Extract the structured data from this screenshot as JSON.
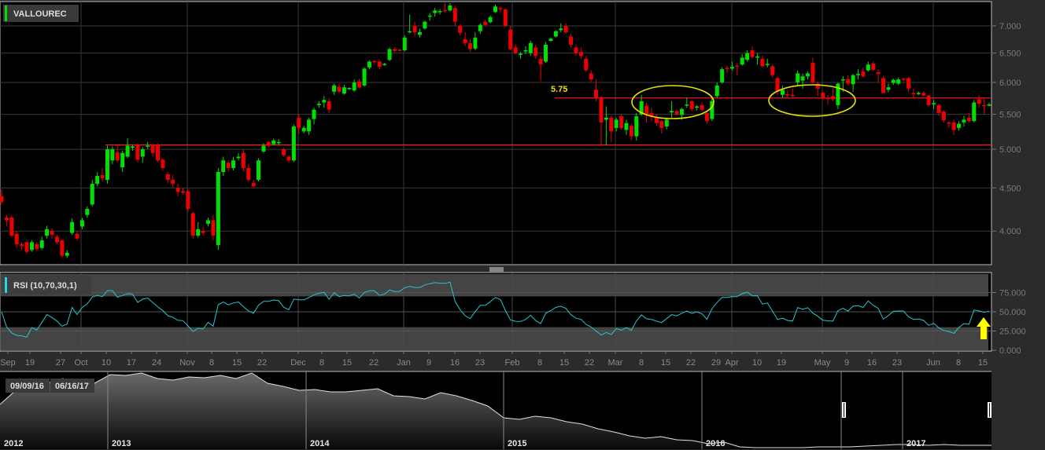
{
  "colors": {
    "background": "#2b2b2b",
    "panel": "#000000",
    "grid": "#3a3a3a",
    "up": "#00e000",
    "down": "#ee0000",
    "hline": "#ff1a1a",
    "annotation": "#e8e000",
    "rsi_line": "#22c8d0",
    "rsi_band": "#444444",
    "navigator_line": "#e0e0e0"
  },
  "chart_data": [
    {
      "type": "candlestick",
      "title": "VALLOUREC",
      "scale": "log",
      "ylim": [
        3.65,
        7.48
      ],
      "grid": true,
      "yticks": [
        {
          "value": 7.0,
          "label": "7.000"
        },
        {
          "value": 6.5,
          "label": "6.500"
        },
        {
          "value": 6.0,
          "label": "6.000"
        },
        {
          "value": 5.5,
          "label": "5.500"
        },
        {
          "value": 5.0,
          "label": "5.000"
        },
        {
          "value": 4.5,
          "label": "4.500"
        },
        {
          "value": 4.0,
          "label": "4.000"
        }
      ],
      "xticks": [
        "Sep",
        "19",
        "27",
        "Oct",
        "10",
        "17",
        "24",
        "Nov",
        "8",
        "15",
        "22",
        "Dec",
        "8",
        "15",
        "22",
        "Jan",
        "9",
        "16",
        "23",
        "Feb",
        "8",
        "15",
        "22",
        "Mar",
        "8",
        "15",
        "22",
        "29",
        "Apr",
        "10",
        "19",
        "May",
        "9",
        "16",
        "23",
        "Jun",
        "8",
        "15"
      ],
      "annotations": {
        "hlines": [
          {
            "value": 5.75,
            "label": "5.75"
          },
          {
            "value": 5.06,
            "label": ""
          }
        ],
        "highlights": [
          "ellipse",
          "ellipse"
        ],
        "arrow": "up"
      },
      "ohlc": [
        [
          4.4,
          4.48,
          4.3,
          4.33
        ],
        [
          4.15,
          4.18,
          4.05,
          4.12
        ],
        [
          4.15,
          4.17,
          3.93,
          3.95
        ],
        [
          3.97,
          4.0,
          3.82,
          3.86
        ],
        [
          3.86,
          3.88,
          3.8,
          3.84
        ],
        [
          3.88,
          3.9,
          3.76,
          3.78
        ],
        [
          3.8,
          3.9,
          3.78,
          3.88
        ],
        [
          3.86,
          3.88,
          3.79,
          3.81
        ],
        [
          3.82,
          3.94,
          3.8,
          3.9
        ],
        [
          3.95,
          4.06,
          3.92,
          4.02
        ],
        [
          4.0,
          4.03,
          3.92,
          3.96
        ],
        [
          3.94,
          3.96,
          3.86,
          3.88
        ],
        [
          3.9,
          3.91,
          3.72,
          3.74
        ],
        [
          3.74,
          3.8,
          3.72,
          3.77
        ],
        [
          3.98,
          4.14,
          3.96,
          4.1
        ],
        [
          3.97,
          4.0,
          3.9,
          3.92
        ],
        [
          4.05,
          4.15,
          4.02,
          4.12
        ],
        [
          4.18,
          4.28,
          4.15,
          4.25
        ],
        [
          4.3,
          4.6,
          4.28,
          4.55
        ],
        [
          4.55,
          4.7,
          4.52,
          4.65
        ],
        [
          4.66,
          4.75,
          4.58,
          4.62
        ],
        [
          4.6,
          5.05,
          4.55,
          5.0
        ],
        [
          4.85,
          5.04,
          4.8,
          5.0
        ],
        [
          4.96,
          5.05,
          4.82,
          4.85
        ],
        [
          4.76,
          4.98,
          4.7,
          4.95
        ],
        [
          4.9,
          5.15,
          4.88,
          5.05
        ],
        [
          5.02,
          5.06,
          4.98,
          5.04
        ],
        [
          5.06,
          5.08,
          4.82,
          4.86
        ],
        [
          4.9,
          5.03,
          4.82,
          5.0
        ],
        [
          5.04,
          5.1,
          5.0,
          5.05
        ],
        [
          5.06,
          5.08,
          4.9,
          4.95
        ],
        [
          5.06,
          5.08,
          4.83,
          4.85
        ],
        [
          4.86,
          4.88,
          4.72,
          4.75
        ],
        [
          4.67,
          4.7,
          4.56,
          4.6
        ],
        [
          4.6,
          4.66,
          4.5,
          4.55
        ],
        [
          4.5,
          4.55,
          4.4,
          4.45
        ],
        [
          4.46,
          4.5,
          4.42,
          4.44
        ],
        [
          4.46,
          4.48,
          4.22,
          4.25
        ],
        [
          4.2,
          4.22,
          3.92,
          3.95
        ],
        [
          3.95,
          4.1,
          3.93,
          4.02
        ],
        [
          4.0,
          4.05,
          3.95,
          3.98
        ],
        [
          4.08,
          4.15,
          4.05,
          4.12
        ],
        [
          4.12,
          4.18,
          3.9,
          3.95
        ],
        [
          3.85,
          4.75,
          3.8,
          4.7
        ],
        [
          4.7,
          4.9,
          4.65,
          4.85
        ],
        [
          4.82,
          4.85,
          4.7,
          4.75
        ],
        [
          4.75,
          4.9,
          4.72,
          4.85
        ],
        [
          4.88,
          4.95,
          4.85,
          4.9
        ],
        [
          4.95,
          5.0,
          4.7,
          4.75
        ],
        [
          4.75,
          4.8,
          4.58,
          4.6
        ],
        [
          4.56,
          4.6,
          4.5,
          4.52
        ],
        [
          4.6,
          4.88,
          4.58,
          4.85
        ],
        [
          4.97,
          5.08,
          4.95,
          5.05
        ],
        [
          5.1,
          5.12,
          5.02,
          5.05
        ],
        [
          5.07,
          5.15,
          5.05,
          5.12
        ],
        [
          5.1,
          5.14,
          5.06,
          5.1
        ],
        [
          5.0,
          5.02,
          4.9,
          4.92
        ],
        [
          4.9,
          4.92,
          4.82,
          4.85
        ],
        [
          4.85,
          5.35,
          4.83,
          5.32
        ],
        [
          5.45,
          5.5,
          5.22,
          5.3
        ],
        [
          5.25,
          5.33,
          5.22,
          5.3
        ],
        [
          5.25,
          5.45,
          5.2,
          5.42
        ],
        [
          5.43,
          5.6,
          5.35,
          5.57
        ],
        [
          5.64,
          5.7,
          5.6,
          5.66
        ],
        [
          5.68,
          5.78,
          5.6,
          5.72
        ],
        [
          5.7,
          5.75,
          5.52,
          5.57
        ],
        [
          5.85,
          5.98,
          5.8,
          5.95
        ],
        [
          5.93,
          5.97,
          5.83,
          5.85
        ],
        [
          5.82,
          5.96,
          5.8,
          5.92
        ],
        [
          5.9,
          5.92,
          5.88,
          5.91
        ],
        [
          5.87,
          6.05,
          5.85,
          6.0
        ],
        [
          6.02,
          6.06,
          5.9,
          5.92
        ],
        [
          5.95,
          6.25,
          5.93,
          6.23
        ],
        [
          6.25,
          6.37,
          6.22,
          6.35
        ],
        [
          6.36,
          6.38,
          6.3,
          6.35
        ],
        [
          6.35,
          6.38,
          6.22,
          6.26
        ],
        [
          6.3,
          6.33,
          6.28,
          6.31
        ],
        [
          6.38,
          6.6,
          6.36,
          6.57
        ],
        [
          6.57,
          6.6,
          6.52,
          6.54
        ],
        [
          6.56,
          6.58,
          6.53,
          6.55
        ],
        [
          6.55,
          6.82,
          6.53,
          6.78
        ],
        [
          6.88,
          7.22,
          6.86,
          6.9
        ],
        [
          7.0,
          7.08,
          6.8,
          6.88
        ],
        [
          6.83,
          6.95,
          6.78,
          6.88
        ],
        [
          6.95,
          7.1,
          6.93,
          7.08
        ],
        [
          7.18,
          7.25,
          7.1,
          7.2
        ],
        [
          7.25,
          7.35,
          7.18,
          7.3
        ],
        [
          7.28,
          7.33,
          7.22,
          7.29
        ],
        [
          7.31,
          7.45,
          7.25,
          7.3
        ],
        [
          7.3,
          7.45,
          7.28,
          7.4
        ],
        [
          7.35,
          7.4,
          7.0,
          7.08
        ],
        [
          7.0,
          7.03,
          6.82,
          6.87
        ],
        [
          6.75,
          6.88,
          6.62,
          6.68
        ],
        [
          6.68,
          6.75,
          6.52,
          6.57
        ],
        [
          6.58,
          6.88,
          6.55,
          6.78
        ],
        [
          6.9,
          7.05,
          6.85,
          7.02
        ],
        [
          7.08,
          7.12,
          7.0,
          7.02
        ],
        [
          7.07,
          7.2,
          7.05,
          7.17
        ],
        [
          7.27,
          7.42,
          7.25,
          7.38
        ],
        [
          7.35,
          7.38,
          7.25,
          7.33
        ],
        [
          7.32,
          7.35,
          6.98,
          7.0
        ],
        [
          6.93,
          7.0,
          6.55,
          6.57
        ],
        [
          6.6,
          6.65,
          6.48,
          6.5
        ],
        [
          6.47,
          6.52,
          6.4,
          6.49
        ],
        [
          6.53,
          6.62,
          6.48,
          6.55
        ],
        [
          6.5,
          6.72,
          6.45,
          6.68
        ],
        [
          6.6,
          6.65,
          6.4,
          6.45
        ],
        [
          6.4,
          6.45,
          6.02,
          6.3
        ],
        [
          6.35,
          6.7,
          6.33,
          6.65
        ],
        [
          6.72,
          6.78,
          6.7,
          6.76
        ],
        [
          6.8,
          6.92,
          6.78,
          6.9
        ],
        [
          6.92,
          7.05,
          6.88,
          6.95
        ],
        [
          7.0,
          7.05,
          6.85,
          6.88
        ],
        [
          6.8,
          6.85,
          6.6,
          6.65
        ],
        [
          6.6,
          6.65,
          6.45,
          6.5
        ],
        [
          6.52,
          6.6,
          6.4,
          6.45
        ],
        [
          6.4,
          6.45,
          6.18,
          6.2
        ],
        [
          6.15,
          6.2,
          6.0,
          6.05
        ],
        [
          5.88,
          6.05,
          5.7,
          5.76
        ],
        [
          5.76,
          5.78,
          5.05,
          5.38
        ],
        [
          5.42,
          5.62,
          5.05,
          5.45
        ],
        [
          5.45,
          5.48,
          5.1,
          5.25
        ],
        [
          5.3,
          5.45,
          5.25,
          5.42
        ],
        [
          5.47,
          5.5,
          5.28,
          5.3
        ],
        [
          5.27,
          5.42,
          5.2,
          5.37
        ],
        [
          5.33,
          5.36,
          5.12,
          5.18
        ],
        [
          5.18,
          5.52,
          5.12,
          5.47
        ],
        [
          5.5,
          5.8,
          5.48,
          5.7
        ],
        [
          5.63,
          5.68,
          5.38,
          5.5
        ],
        [
          5.52,
          5.6,
          5.4,
          5.46
        ],
        [
          5.46,
          5.5,
          5.33,
          5.37
        ],
        [
          5.4,
          5.42,
          5.22,
          5.3
        ],
        [
          5.32,
          5.45,
          5.28,
          5.42
        ],
        [
          5.53,
          5.7,
          5.45,
          5.55
        ],
        [
          5.55,
          5.58,
          5.48,
          5.5
        ],
        [
          5.49,
          5.6,
          5.42,
          5.58
        ],
        [
          5.64,
          5.76,
          5.6,
          5.65
        ],
        [
          5.7,
          5.72,
          5.55,
          5.58
        ],
        [
          5.6,
          5.64,
          5.56,
          5.62
        ],
        [
          5.64,
          5.68,
          5.55,
          5.57
        ],
        [
          5.52,
          5.55,
          5.36,
          5.4
        ],
        [
          5.43,
          5.75,
          5.4,
          5.7
        ],
        [
          5.78,
          6.0,
          5.75,
          5.95
        ],
        [
          6.0,
          6.25,
          5.98,
          6.22
        ],
        [
          6.24,
          6.28,
          6.15,
          6.22
        ],
        [
          6.23,
          6.35,
          6.2,
          6.26
        ],
        [
          6.28,
          6.32,
          6.12,
          6.27
        ],
        [
          6.3,
          6.48,
          6.28,
          6.42
        ],
        [
          6.38,
          6.55,
          6.35,
          6.5
        ],
        [
          6.55,
          6.62,
          6.4,
          6.43
        ],
        [
          6.43,
          6.5,
          6.3,
          6.44
        ],
        [
          6.4,
          6.45,
          6.25,
          6.27
        ],
        [
          6.29,
          6.4,
          6.25,
          6.31
        ],
        [
          6.27,
          6.3,
          6.08,
          6.12
        ],
        [
          6.07,
          6.1,
          5.8,
          5.85
        ],
        [
          5.8,
          5.95,
          5.75,
          5.88
        ],
        [
          5.81,
          5.88,
          5.75,
          5.8
        ],
        [
          5.8,
          5.9,
          5.75,
          5.78
        ],
        [
          6.0,
          6.2,
          5.95,
          6.15
        ],
        [
          6.03,
          6.15,
          5.9,
          6.1
        ],
        [
          6.1,
          6.18,
          6.05,
          6.15
        ],
        [
          6.33,
          6.42,
          5.98,
          6.0
        ],
        [
          5.98,
          6.02,
          5.78,
          5.9
        ],
        [
          5.83,
          5.85,
          5.72,
          5.76
        ],
        [
          5.75,
          5.8,
          5.65,
          5.74
        ],
        [
          5.78,
          5.9,
          5.7,
          5.73
        ],
        [
          5.64,
          6.0,
          5.58,
          5.98
        ],
        [
          6.05,
          6.1,
          5.85,
          6.05
        ],
        [
          6.05,
          6.12,
          5.95,
          5.98
        ],
        [
          5.97,
          6.14,
          5.85,
          6.12
        ],
        [
          6.12,
          6.22,
          6.05,
          6.14
        ],
        [
          6.18,
          6.25,
          6.08,
          6.1
        ],
        [
          6.2,
          6.35,
          6.18,
          6.3
        ],
        [
          6.32,
          6.35,
          6.18,
          6.21
        ],
        [
          6.17,
          6.22,
          6.0,
          6.14
        ],
        [
          6.07,
          6.1,
          5.82,
          5.83
        ],
        [
          5.88,
          5.98,
          5.84,
          5.92
        ],
        [
          5.99,
          6.06,
          5.96,
          6.04
        ],
        [
          5.98,
          6.08,
          5.96,
          6.05
        ],
        [
          6.06,
          6.08,
          6.0,
          6.05
        ],
        [
          6.07,
          6.09,
          5.85,
          5.9
        ],
        [
          5.83,
          5.9,
          5.75,
          5.82
        ],
        [
          5.82,
          5.85,
          5.8,
          5.83
        ],
        [
          5.83,
          5.86,
          5.77,
          5.79
        ],
        [
          5.79,
          5.8,
          5.62,
          5.64
        ],
        [
          5.66,
          5.72,
          5.58,
          5.67
        ],
        [
          5.64,
          5.66,
          5.48,
          5.52
        ],
        [
          5.54,
          5.56,
          5.38,
          5.41
        ],
        [
          5.38,
          5.4,
          5.3,
          5.36
        ],
        [
          5.38,
          5.42,
          5.2,
          5.27
        ],
        [
          5.3,
          5.4,
          5.26,
          5.36
        ],
        [
          5.38,
          5.48,
          5.32,
          5.42
        ],
        [
          5.45,
          5.52,
          5.38,
          5.4
        ],
        [
          5.4,
          5.72,
          5.38,
          5.68
        ],
        [
          5.73,
          5.8,
          5.6,
          5.66
        ],
        [
          5.64,
          5.75,
          5.5,
          5.63
        ],
        [
          5.64,
          5.68,
          5.62,
          5.65
        ]
      ]
    },
    {
      "type": "line",
      "title": "RSI (10,70,30,1)",
      "period": 10,
      "overbought": 70,
      "oversold": 30,
      "ylim": [
        0,
        100
      ],
      "yticks": [
        {
          "value": 75,
          "label": "75.000"
        },
        {
          "value": 50,
          "label": "50.000"
        },
        {
          "value": 25,
          "label": "25.000"
        },
        {
          "value": 0,
          "label": "0.000"
        }
      ]
    },
    {
      "type": "area",
      "role": "navigator",
      "range_labels": [
        "09/09/16",
        "06/16/17"
      ],
      "years": [
        "2012",
        "2013",
        "2014",
        "2015",
        "2016",
        "2017"
      ],
      "values": [
        56,
        74,
        79,
        83,
        89,
        81,
        83,
        94,
        93,
        96,
        89,
        87,
        91,
        90,
        93,
        89,
        96,
        83,
        79,
        74,
        75,
        72,
        72,
        74,
        76,
        67,
        66,
        63,
        71,
        67,
        61,
        54,
        39,
        37,
        41,
        39,
        34,
        31,
        25,
        21,
        16,
        13,
        15,
        11,
        10,
        6,
        8,
        2,
        1,
        1,
        1,
        1,
        2,
        2,
        2,
        3,
        4,
        5,
        5,
        4,
        5,
        4,
        4,
        4
      ]
    }
  ]
}
